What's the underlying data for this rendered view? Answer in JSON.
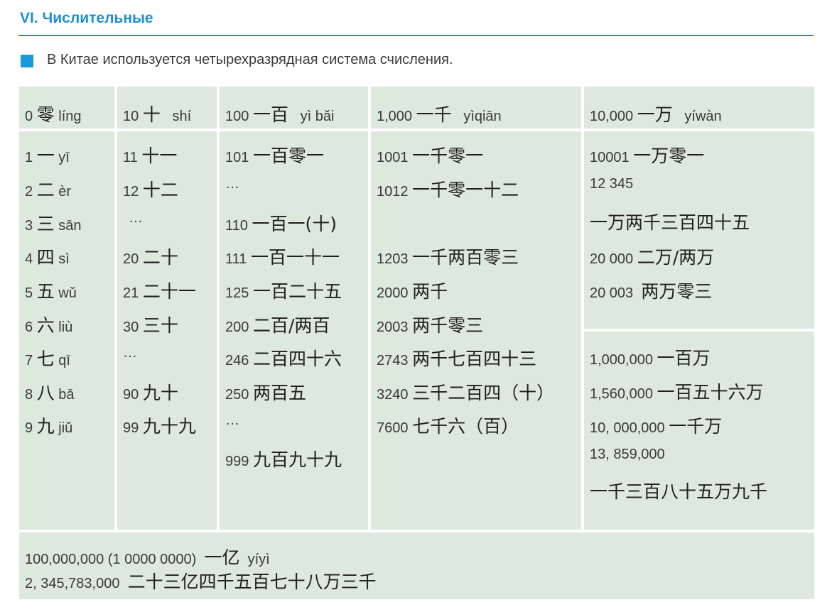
{
  "section_title": "VI. Числительные",
  "intro_text": "В Китае используется четырехразрядная система счисления.",
  "headers": [
    {
      "num": "0",
      "zh": "零",
      "py": "líng"
    },
    {
      "num": "10",
      "zh": "十",
      "py": "shí"
    },
    {
      "num": "100",
      "zh": "一百",
      "py": "yì bǎi"
    },
    {
      "num": "1,000",
      "zh": "一千",
      "py": "yìqiān"
    },
    {
      "num": "10,000",
      "zh": "一万",
      "py": "yíwàn"
    }
  ],
  "col1": [
    {
      "num": "1",
      "zh": "一",
      "py": "yī"
    },
    {
      "num": "2",
      "zh": "二",
      "py": "èr"
    },
    {
      "num": "3",
      "zh": "三",
      "py": "sān"
    },
    {
      "num": "4",
      "zh": "四",
      "py": "sì"
    },
    {
      "num": "5",
      "zh": "五",
      "py": "wǔ"
    },
    {
      "num": "6",
      "zh": "六",
      "py": "liù"
    },
    {
      "num": "7",
      "zh": "七",
      "py": "qī"
    },
    {
      "num": "8",
      "zh": "八",
      "py": "bā"
    },
    {
      "num": "9",
      "zh": "九",
      "py": "jiǔ"
    }
  ],
  "col2": [
    {
      "num": "11",
      "zh": "十一"
    },
    {
      "num": "12",
      "zh": "十二"
    },
    {
      "num": "…",
      "zh": ""
    },
    {
      "num": "20",
      "zh": "二十"
    },
    {
      "num": "21",
      "zh": "二十一"
    },
    {
      "num": "30",
      "zh": "三十"
    },
    {
      "num": "…",
      "zh": ""
    },
    {
      "num": "90",
      "zh": "九十"
    },
    {
      "num": "99",
      "zh": "九十九"
    }
  ],
  "col3": [
    {
      "num": "101",
      "zh": "一百零一"
    },
    {
      "num": "…",
      "zh": ""
    },
    {
      "num": "110",
      "zh": "一百一(十)"
    },
    {
      "num": "111",
      "zh": "一百一十一"
    },
    {
      "num": "125",
      "zh": "一百二十五"
    },
    {
      "num": "200",
      "zh": "二百/两百"
    },
    {
      "num": "246",
      "zh": "二百四十六"
    },
    {
      "num": "250",
      "zh": "两百五"
    },
    {
      "num": "…",
      "zh": ""
    },
    {
      "num": "999",
      "zh": "九百九十九"
    }
  ],
  "col4": [
    {
      "num": "1001",
      "zh": "一千零一"
    },
    {
      "num": "1012",
      "zh": "一千零一十二"
    },
    {
      "num": "1203",
      "zh": "一千两百零三"
    },
    {
      "num": "2000",
      "zh": "两千"
    },
    {
      "num": "2003",
      "zh": "两千零三"
    },
    {
      "num": "2743",
      "zh": "两千七百四十三"
    },
    {
      "num": "3240",
      "zh": "三千二百四（十）"
    },
    {
      "num": "7600",
      "zh": "七千六（百）"
    }
  ],
  "col5_top": [
    {
      "num": "10001",
      "zh": "一万零一"
    },
    {
      "num": "12 345",
      "zh": ""
    },
    {
      "num": "",
      "zh": "一万两千三百四十五"
    },
    {
      "num": "20 000",
      "zh": "二万/两万"
    },
    {
      "num": "20 003",
      "zh": "两万零三"
    }
  ],
  "col5_bottom": [
    {
      "num": "1,000,000",
      "zh": "一百万"
    },
    {
      "num": "1,560,000",
      "zh": "一百五十六万"
    },
    {
      "num": "10, 000,000",
      "zh": "一千万"
    },
    {
      "num": "13, 859,000",
      "zh": ""
    },
    {
      "num": "",
      "zh": "一千三百八十五万九千"
    }
  ],
  "footer": [
    {
      "num": "100,000,000  (1 0000 0000)",
      "zh": "一亿",
      "py": "yíyì"
    },
    {
      "num": "2, 345,783,000",
      "zh": "二十三亿四千五百七十八万三千",
      "py": ""
    }
  ]
}
